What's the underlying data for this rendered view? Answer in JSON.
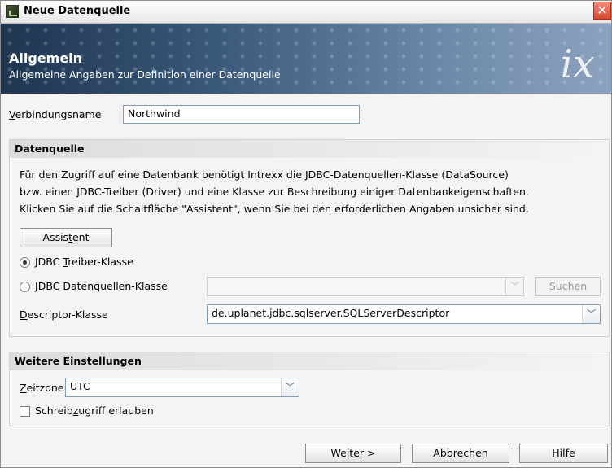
{
  "window": {
    "title": "Neue Datenquelle",
    "close_glyph": "✕"
  },
  "banner": {
    "title": "Allgemein",
    "subtitle": "Allgemeine Angaben zur Definition einer Datenquelle",
    "logo": "ix"
  },
  "connection": {
    "label_pre": "",
    "label_mnemonic": "V",
    "label_post": "erbindungsname",
    "value": "Northwind"
  },
  "datasource": {
    "header": "Datenquelle",
    "description": [
      "Für den Zugriff auf eine Datenbank benötigt Intrexx die JDBC-Datenquellen-Klasse (DataSource)",
      "bzw. einen JDBC-Treiber (Driver) und eine Klasse zur Beschreibung einiger Datenbankeigenschaften.",
      "Klicken Sie auf die Schaltfläche \"Assistent\", wenn Sie bei den erforderlichen Angaben unsicher sind."
    ],
    "assistant_button": {
      "pre": "Assis",
      "mnemonic": "t",
      "post": "ent"
    },
    "driver_radio": {
      "pre": "JDBC ",
      "mnemonic": "T",
      "post": "reiber-Klasse",
      "checked": true
    },
    "datasource_radio": {
      "pre": "",
      "mnemonic": "J",
      "post": "DBC Datenquellen-Klasse",
      "checked": false,
      "value": ""
    },
    "search_button": {
      "pre": "",
      "mnemonic": "S",
      "post": "uchen"
    },
    "descriptor": {
      "pre": "",
      "mnemonic": "D",
      "post": "escriptor-Klasse",
      "value": "de.uplanet.jdbc.sqlserver.SQLServerDescriptor"
    }
  },
  "settings": {
    "header": "Weitere Einstellungen",
    "timezone": {
      "pre": "",
      "mnemonic": "Z",
      "post": "eitzone",
      "value": "UTC"
    },
    "write_access": {
      "pre": "Schreib",
      "mnemonic": "z",
      "post": "ugriff erlauben",
      "checked": false
    }
  },
  "footer": {
    "next": "Weiter >",
    "cancel": "Abbrechen",
    "help": "Hilfe"
  },
  "dropdown_glyph": "﹀"
}
